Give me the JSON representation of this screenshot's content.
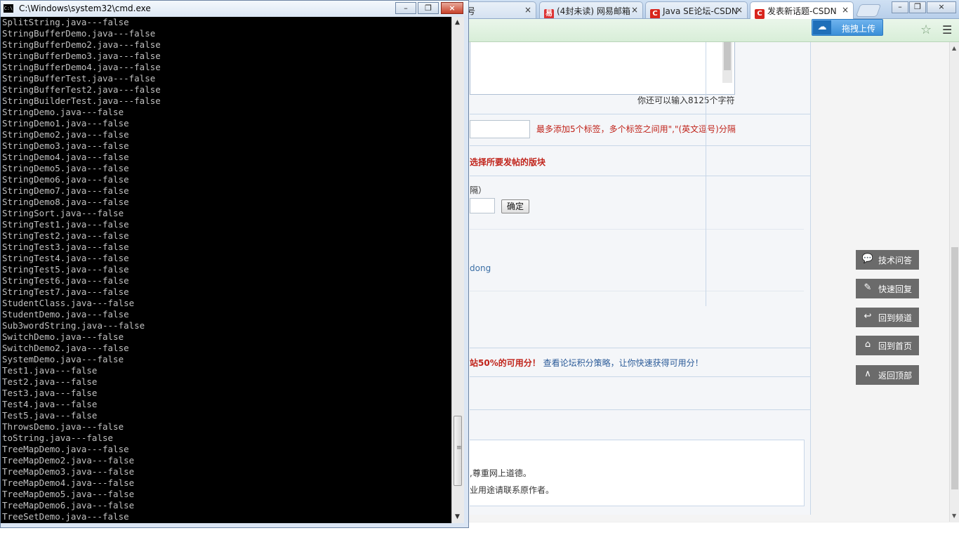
{
  "browser": {
    "tabs": [
      {
        "title": "帐号",
        "favicon": "page-icon",
        "active": false
      },
      {
        "title": "(4封未读) 网易邮箱",
        "favicon": "netease-mail-icon",
        "active": false
      },
      {
        "title": "Java SE论坛-CSDN",
        "favicon": "csdn-icon",
        "active": false
      },
      {
        "title": "发表新话题-CSDN",
        "favicon": "csdn-icon",
        "active": true
      }
    ],
    "tab_close_glyph": "×",
    "window_controls": [
      "–",
      "❐",
      "×"
    ],
    "upload_button": "拖拽上传",
    "page": {
      "char_count": "你还可以输入8125个字符",
      "tag_hint": "最多添加5个标签，多个标签之间用\",\"(英文逗号)分隔",
      "board_label": "选择所要发帖的版块",
      "paren_text": "隔）",
      "confirm_button": "确定",
      "user_link": "dong",
      "points_red": "站50%的可用分！",
      "points_blue": "查看论坛积分策略，让你快速获得可用分！",
      "rule_1": ",尊重网上道德。",
      "rule_2": "业用途请联系原作者。"
    },
    "side_buttons": [
      {
        "label": "技术问答",
        "icon": "chat-bubble-icon",
        "glyph": "💬"
      },
      {
        "label": "快速回复",
        "icon": "pencil-icon",
        "glyph": "✎"
      },
      {
        "label": "回到频道",
        "icon": "reply-arrow-icon",
        "glyph": "↩"
      },
      {
        "label": "回到首页",
        "icon": "home-icon",
        "glyph": "⌂"
      },
      {
        "label": "返回顶部",
        "icon": "chevron-up-icon",
        "glyph": "∧"
      }
    ]
  },
  "cmd": {
    "title": "C:\\Windows\\system32\\cmd.exe",
    "icon_text": "C:\\",
    "controls": {
      "minimize": "–",
      "maximize": "❐",
      "close": "×"
    },
    "lines": [
      "SplitString.java---false",
      "StringBufferDemo.java---false",
      "StringBufferDemo2.java---false",
      "StringBufferDemo3.java---false",
      "StringBufferDemo4.java---false",
      "StringBufferTest.java---false",
      "StringBufferTest2.java---false",
      "StringBuilderTest.java---false",
      "StringDemo.java---false",
      "StringDemo1.java---false",
      "StringDemo2.java---false",
      "StringDemo3.java---false",
      "StringDemo4.java---false",
      "StringDemo5.java---false",
      "StringDemo6.java---false",
      "StringDemo7.java---false",
      "StringDemo8.java---false",
      "StringSort.java---false",
      "StringTest1.java---false",
      "StringTest2.java---false",
      "StringTest3.java---false",
      "StringTest4.java---false",
      "StringTest5.java---false",
      "StringTest6.java---false",
      "StringTest7.java---false",
      "StudentClass.java---false",
      "StudentDemo.java---false",
      "Sub3wordString.java---false",
      "SwitchDemo.java---false",
      "SwitchDemo2.java---false",
      "SystemDemo.java---false",
      "Test1.java---false",
      "Test2.java---false",
      "Test3.java---false",
      "Test4.java---false",
      "Test5.java---false",
      "ThrowsDemo.java---false",
      "toString.java---false",
      "TreeMapDemo.java---false",
      "TreeMapDemo2.java---false",
      "TreeMapDemo3.java---false",
      "TreeMapDemo4.java---false",
      "TreeMapDemo5.java---false",
      "TreeMapDemo6.java---false",
      "TreeSetDemo.java---false"
    ]
  }
}
